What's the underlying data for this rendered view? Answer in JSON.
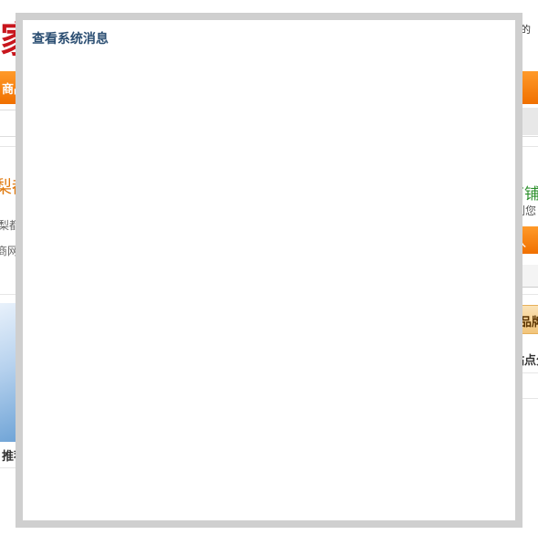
{
  "background_page": {
    "logo_fragment": "家",
    "top_right_link": "我的",
    "nav_item": "商品",
    "heading_left": "梨都",
    "text_left_1": "梨都",
    "text_left_2": "商网为",
    "heading_right": "商铺",
    "text_right_1": "到您",
    "button_right": "入",
    "tag_right": "品牌",
    "text_right_2": "站点分",
    "text_left_3": "推荐"
  },
  "modal": {
    "title": "查看系统消息"
  },
  "colors": {
    "modal_border": "#cfcfcf",
    "modal_title": "#2b4e72",
    "nav_orange": "#f07000",
    "logo_red": "#c8161d"
  }
}
